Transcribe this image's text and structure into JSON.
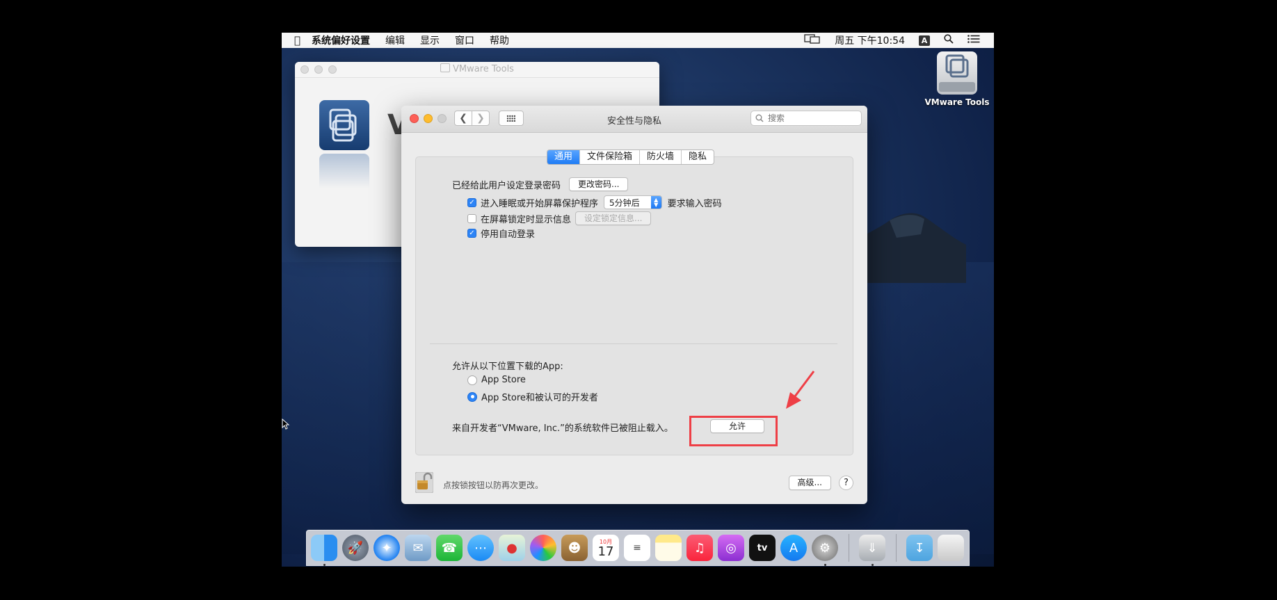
{
  "menubar": {
    "app_name": "系统偏好设置",
    "items": [
      "编辑",
      "显示",
      "窗口",
      "帮助"
    ],
    "clock": "周五 下午10:54",
    "input_method": "A"
  },
  "desktop": {
    "disk_label": "VMware Tools"
  },
  "vmware_window": {
    "title": "VMware Tools",
    "big_letter": "V"
  },
  "prefs": {
    "title": "安全性与隐私",
    "search_placeholder": "搜索",
    "tabs": [
      {
        "label": "通用",
        "active": true
      },
      {
        "label": "文件保险箱",
        "active": false
      },
      {
        "label": "防火墙",
        "active": false
      },
      {
        "label": "隐私",
        "active": false
      }
    ],
    "password_text": "已经给此用户设定登录密码",
    "change_password_button": "更改密码...",
    "sleep_checkbox": {
      "label": "进入睡眠或开始屏幕保护程序",
      "checked": true
    },
    "sleep_delay": "5分钟后",
    "sleep_suffix": "要求输入密码",
    "lock_message_checkbox": {
      "label": "在屏幕锁定时显示信息",
      "checked": false
    },
    "set_lock_message_button": "设定锁定信息...",
    "disable_autologin_checkbox": {
      "label": "停用自动登录",
      "checked": true
    },
    "allow_apps_title": "允许从以下位置下载的App:",
    "radio_app_store": {
      "label": "App Store",
      "selected": false
    },
    "radio_app_store_identified": {
      "label": "App Store和被认可的开发者",
      "selected": true
    },
    "blocked_message": "来自开发者“VMware, Inc.”的系统软件已被阻止载入。",
    "allow_button": "允许",
    "lock_text": "点按锁按钮以防再次更改。",
    "advanced_button": "高级...",
    "help_button": "?"
  },
  "annotation": {
    "highlight_color": "#ee3f46"
  },
  "dock": {
    "items": [
      "finder-icon",
      "launchpad-icon",
      "safari-icon",
      "mail-icon",
      "facetime-icon",
      "messages-icon",
      "maps-icon",
      "photos-icon",
      "contacts-icon",
      "calendar-icon",
      "reminders-icon",
      "notes-icon",
      "music-icon",
      "podcasts-icon",
      "tv-icon",
      "app-store-icon",
      "system-preferences-icon",
      "installer-icon",
      "downloads-icon",
      "trash-icon"
    ],
    "calendar_month": "10月",
    "calendar_day": "17",
    "tv_label": "tv"
  },
  "colors": {
    "accent": "#2d84f6",
    "close": "#fd5f57",
    "minimize": "#febc2e"
  }
}
